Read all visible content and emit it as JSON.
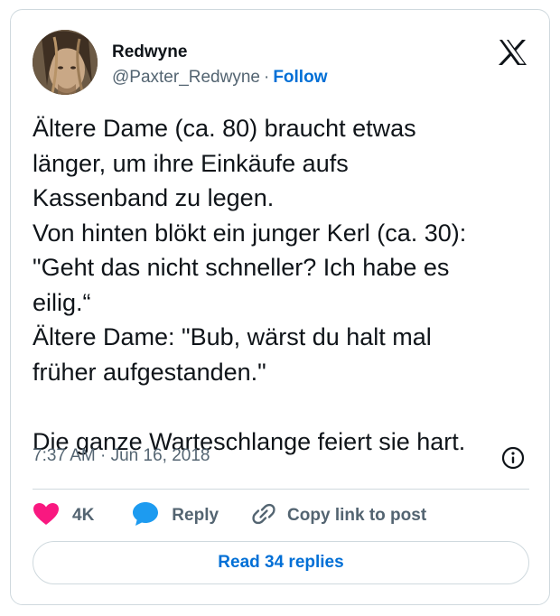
{
  "author": {
    "name": "Redwyne",
    "handle": "@Paxter_Redwyne",
    "separator": "·",
    "follow_label": "Follow"
  },
  "tweet": {
    "lines": [
      "Ältere Dame (ca. 80) braucht etwas",
      "länger, um ihre Einkäufe aufs",
      "Kassenband zu legen.",
      "Von hinten blökt ein junger Kerl (ca. 30):",
      "\"Geht das nicht schneller? Ich habe es",
      "eilig.“",
      "Ältere Dame: \"Bub, wärst du halt mal",
      "früher aufgestanden.\"",
      "",
      "Die ganze Warteschlange feiert sie hart."
    ],
    "timestamp": "7:37 AM · Jun 16, 2018"
  },
  "actions": {
    "like_count": "4K",
    "reply_label": "Reply",
    "copy_label": "Copy link to post"
  },
  "read_replies_label": "Read 34 replies",
  "icons": {
    "logo": "x-logo-icon",
    "info": "info-icon",
    "like": "heart-icon",
    "reply": "speech-bubble-icon",
    "copy": "link-icon"
  },
  "colors": {
    "heart": "#f91880",
    "reply": "#1d9bf0",
    "link": "#006fd6",
    "muted": "#536471",
    "border": "#cfd9de"
  }
}
